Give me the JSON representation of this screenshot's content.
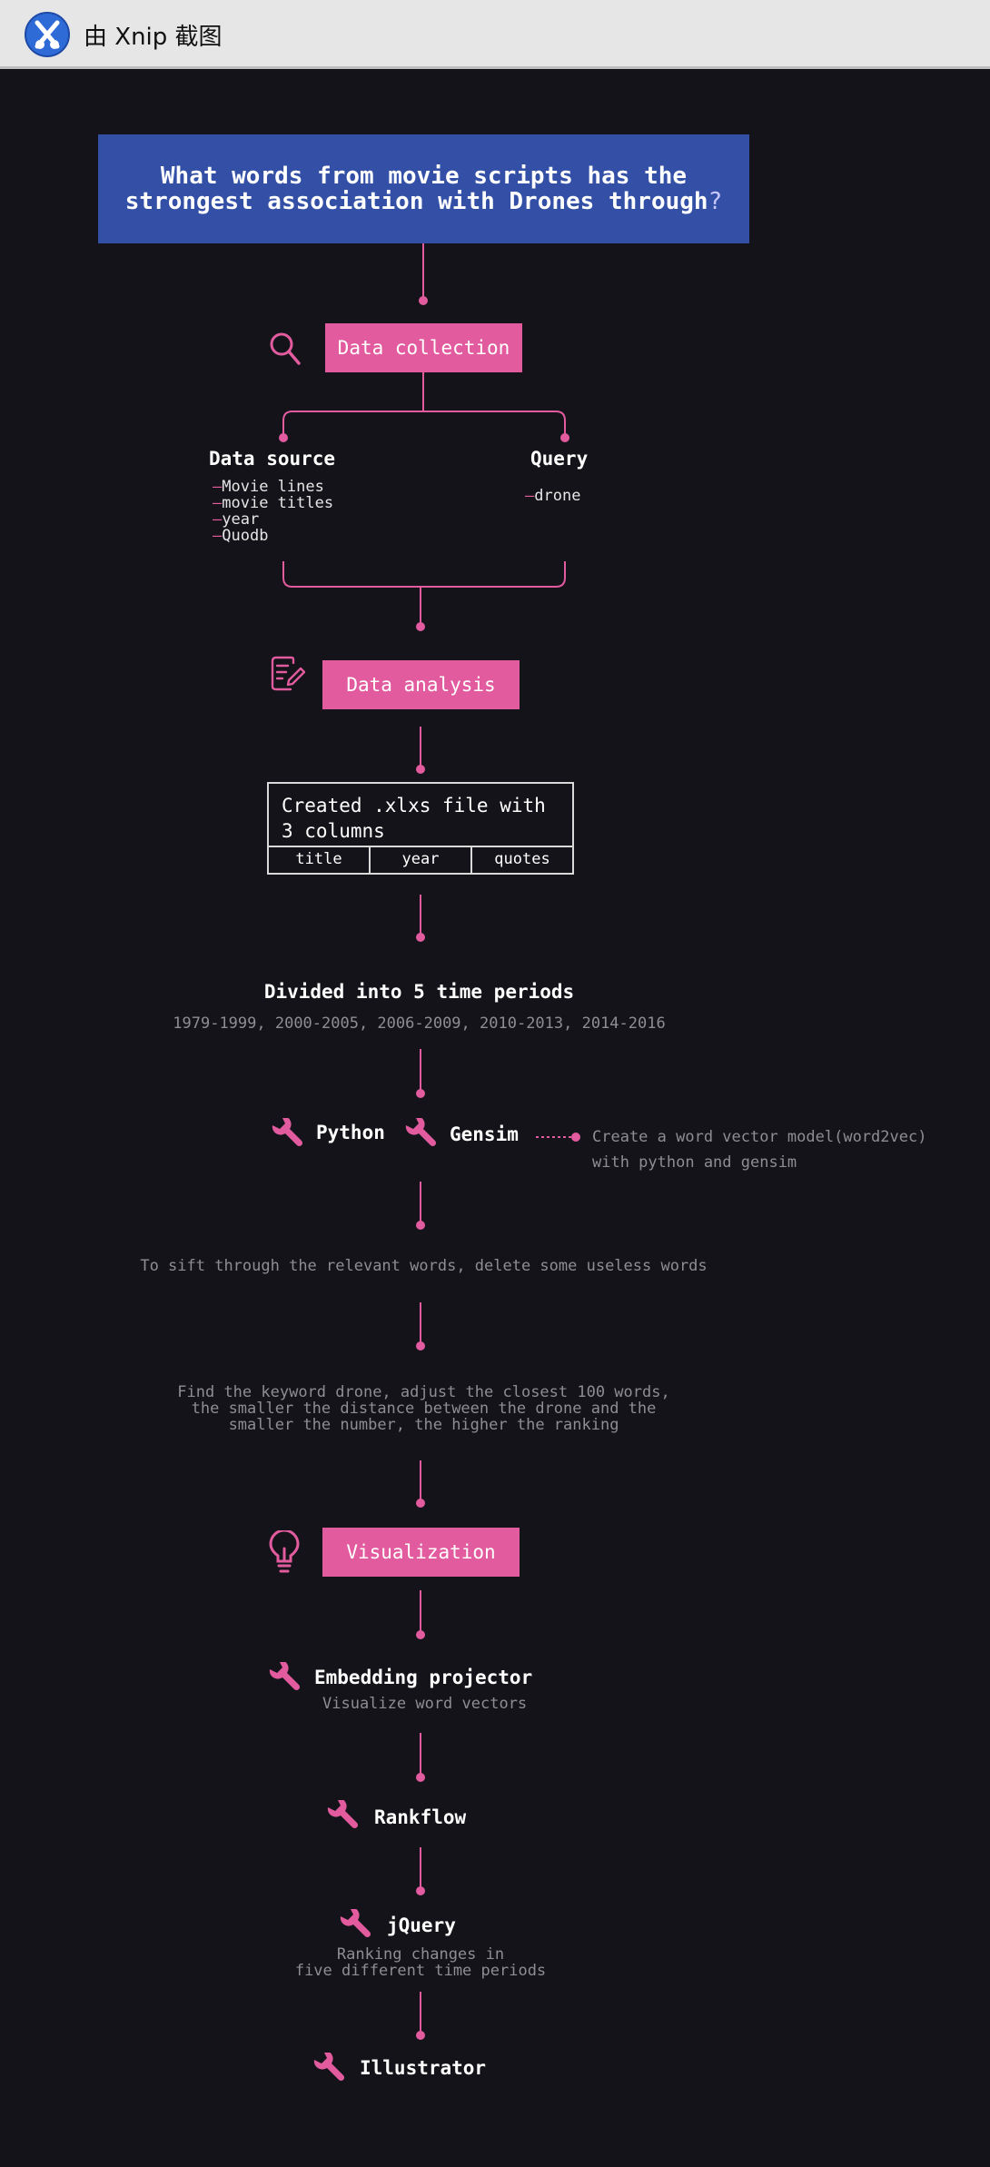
{
  "window": {
    "title": "由 Xnip 截图"
  },
  "colors": {
    "accent": "#e15b9e",
    "title_bg": "#3450a6",
    "background": "#131319"
  },
  "title": {
    "text": "What words from movie scripts has the\nstrongest association with Drones through",
    "qmark": "?"
  },
  "stages": {
    "data_collection": {
      "label": "Data collection",
      "icon": "magnifier-icon"
    },
    "data_analysis": {
      "label": "Data analysis",
      "icon": "notepad-pen-icon"
    },
    "visualization": {
      "label": "Visualization",
      "icon": "lightbulb-icon"
    }
  },
  "data_source": {
    "heading": "Data source",
    "items": [
      "Movie lines",
      "movie titles",
      "year",
      "Quodb"
    ]
  },
  "query": {
    "heading": "Query",
    "items": [
      "drone"
    ]
  },
  "xlsx": {
    "title_line1": "Created .xlxs file with",
    "title_line2": "3 columns",
    "columns": [
      "title",
      "year",
      "quotes"
    ]
  },
  "periods": {
    "heading": "Divided into 5 time periods",
    "values": "1979-1999, 2000-2005, 2006-2009, 2010-2013, 2014-2016"
  },
  "tools_row": {
    "python": "Python",
    "gensim": "Gensim",
    "note_line1": "Create a word vector model(word2vec)",
    "note_line2": "with python and gensim"
  },
  "sift_step": "To sift through the relevant words, delete some useless words",
  "keyword_step": {
    "line1": "Find the keyword drone, adjust the closest 100 words,",
    "line2": "the smaller the distance between the drone and the",
    "line3": "smaller the number, the higher the ranking"
  },
  "viz_tools": {
    "embedding": {
      "name": "Embedding projector",
      "desc": "Visualize word vectors"
    },
    "rankflow": {
      "name": "Rankflow"
    },
    "jquery": {
      "name": "jQuery",
      "desc_line1": "Ranking changes in",
      "desc_line2": "five different time periods"
    },
    "illustrator": {
      "name": "Illustrator"
    }
  }
}
